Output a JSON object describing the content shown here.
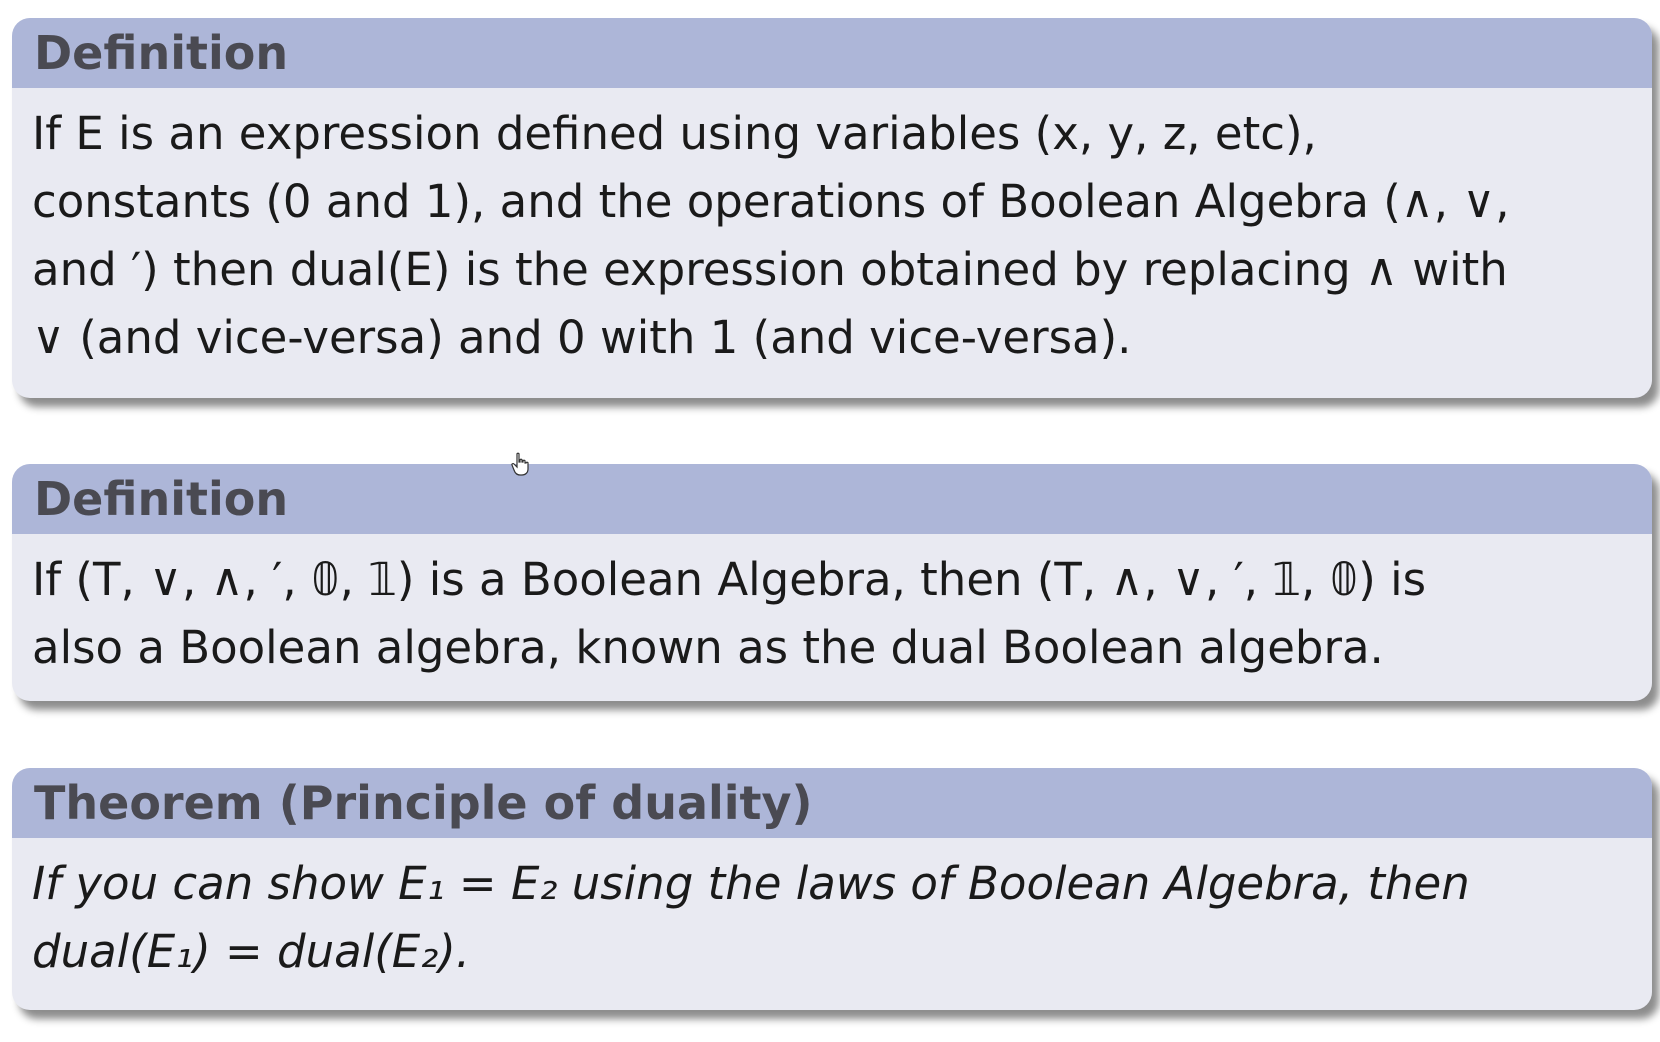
{
  "blocks": [
    {
      "title": "Definition",
      "lines": [
        "If E is an expression defined using variables (x, y, z, etc),",
        "constants (0 and 1), and the operations of Boolean Algebra (∧, ∨,",
        "and ′) then dual(E) is the expression obtained by replacing ∧ with",
        "∨ (and vice-versa) and 0 with 1 (and vice-versa)."
      ]
    },
    {
      "title": "Definition",
      "lines": [
        "If (T, ∨, ∧, ′, 𝟘, 𝟙) is a Boolean Algebra, then (T, ∧, ∨, ′, 𝟙, 𝟘) is",
        "also a Boolean algebra, known as the dual Boolean algebra."
      ]
    },
    {
      "title": "Theorem (Principle of duality)",
      "lines": [
        "If you can show E₁ = E₂ using the laws of Boolean Algebra, then",
        "dual(E₁) = dual(E₂)."
      ]
    }
  ],
  "colors": {
    "title_bar": "#adb6d8",
    "block_body": "#e9eaf2",
    "title_text": "#4a4a52",
    "math_gray": "#6e6e70"
  },
  "icons": {
    "cursor": "hand-pointer-icon"
  }
}
